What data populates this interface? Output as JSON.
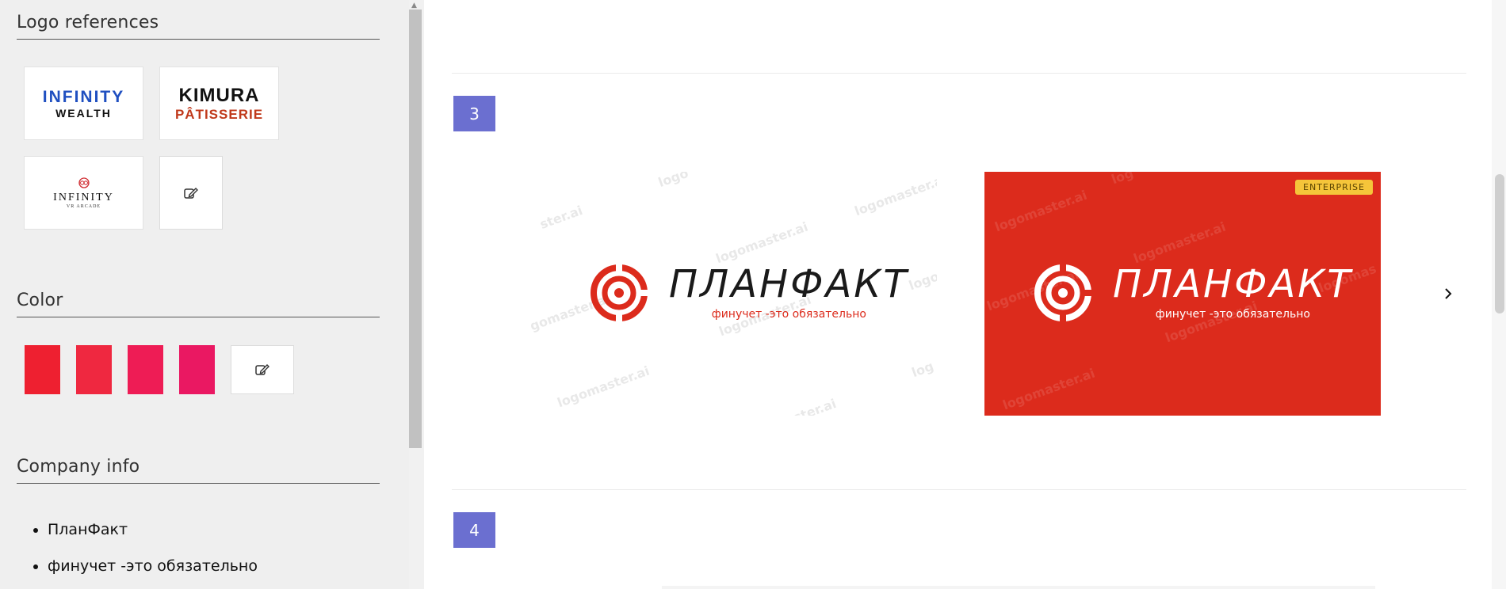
{
  "sidebar": {
    "logo_references_title": "Logo references",
    "color_title": "Color",
    "company_info_title": "Company info",
    "references": [
      {
        "line1": "INFINITY",
        "line2": "WEALTH"
      },
      {
        "line1": "KIMURA",
        "line2": "PÂTISSERIE"
      },
      {
        "line1": "INFINITY",
        "line2": "VR ARCADE"
      }
    ],
    "colors": [
      "#ee2030",
      "#ef2840",
      "#ee1c55",
      "#ea1862"
    ],
    "company_info": [
      "ПланФакт",
      "финучет -это обязательно"
    ]
  },
  "main": {
    "section_3": "3",
    "section_4": "4",
    "logo_name": "ПЛАНФАКТ",
    "logo_tagline": "финучет -это обязательно",
    "enterprise_badge": "ENTERPRISE",
    "watermark": "logomaster.ai",
    "watermark_partials": [
      "ster.ai",
      "logo",
      "logomas",
      "gomaster.ai",
      "log"
    ]
  },
  "colors": {
    "accent": "#6b6fd0",
    "logo_red": "#dc2b1c",
    "enterprise_yellow": "#f5c53a"
  }
}
